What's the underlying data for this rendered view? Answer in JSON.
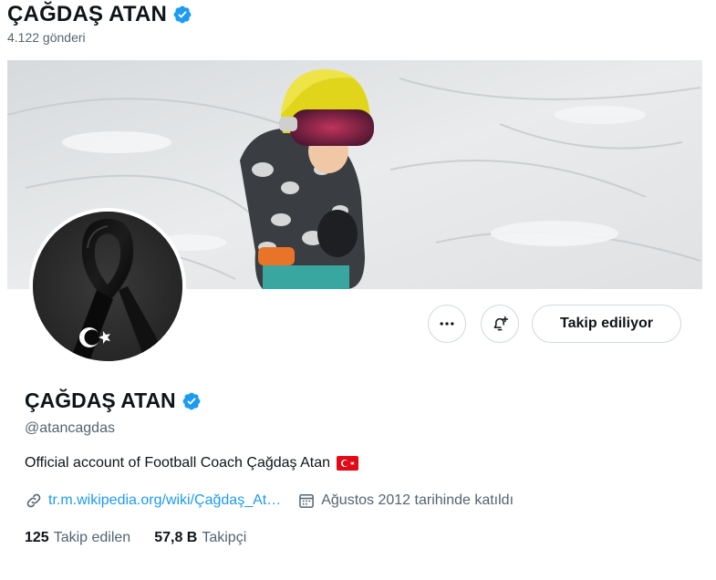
{
  "header": {
    "display_name": "ÇAĞDAŞ ATAN",
    "post_count": "4.122 gönderi"
  },
  "actions": {
    "follow_label": "Takip ediliyor"
  },
  "profile": {
    "display_name": "ÇAĞDAŞ ATAN",
    "handle": "@atancagdas",
    "bio": "Official account of Football Coach Çağdaş Atan",
    "website": "tr.m.wikipedia.org/wiki/Çağdaş_At…",
    "joined": "Ağustos 2012 tarihinde katıldı"
  },
  "stats": {
    "following_count": "125",
    "following_label": "Takip edilen",
    "followers_count": "57,8 B",
    "followers_label": "Takipçi"
  },
  "icons": {
    "verified": "verified-badge-icon",
    "more": "more-dots-icon",
    "notify": "bell-plus-icon",
    "link": "link-icon",
    "calendar": "calendar-icon",
    "flag": "turkey-flag-icon"
  },
  "colors": {
    "accent": "#1d9bf0",
    "text_primary": "#0f1419",
    "text_secondary": "#536471",
    "border": "#cfd9de"
  }
}
